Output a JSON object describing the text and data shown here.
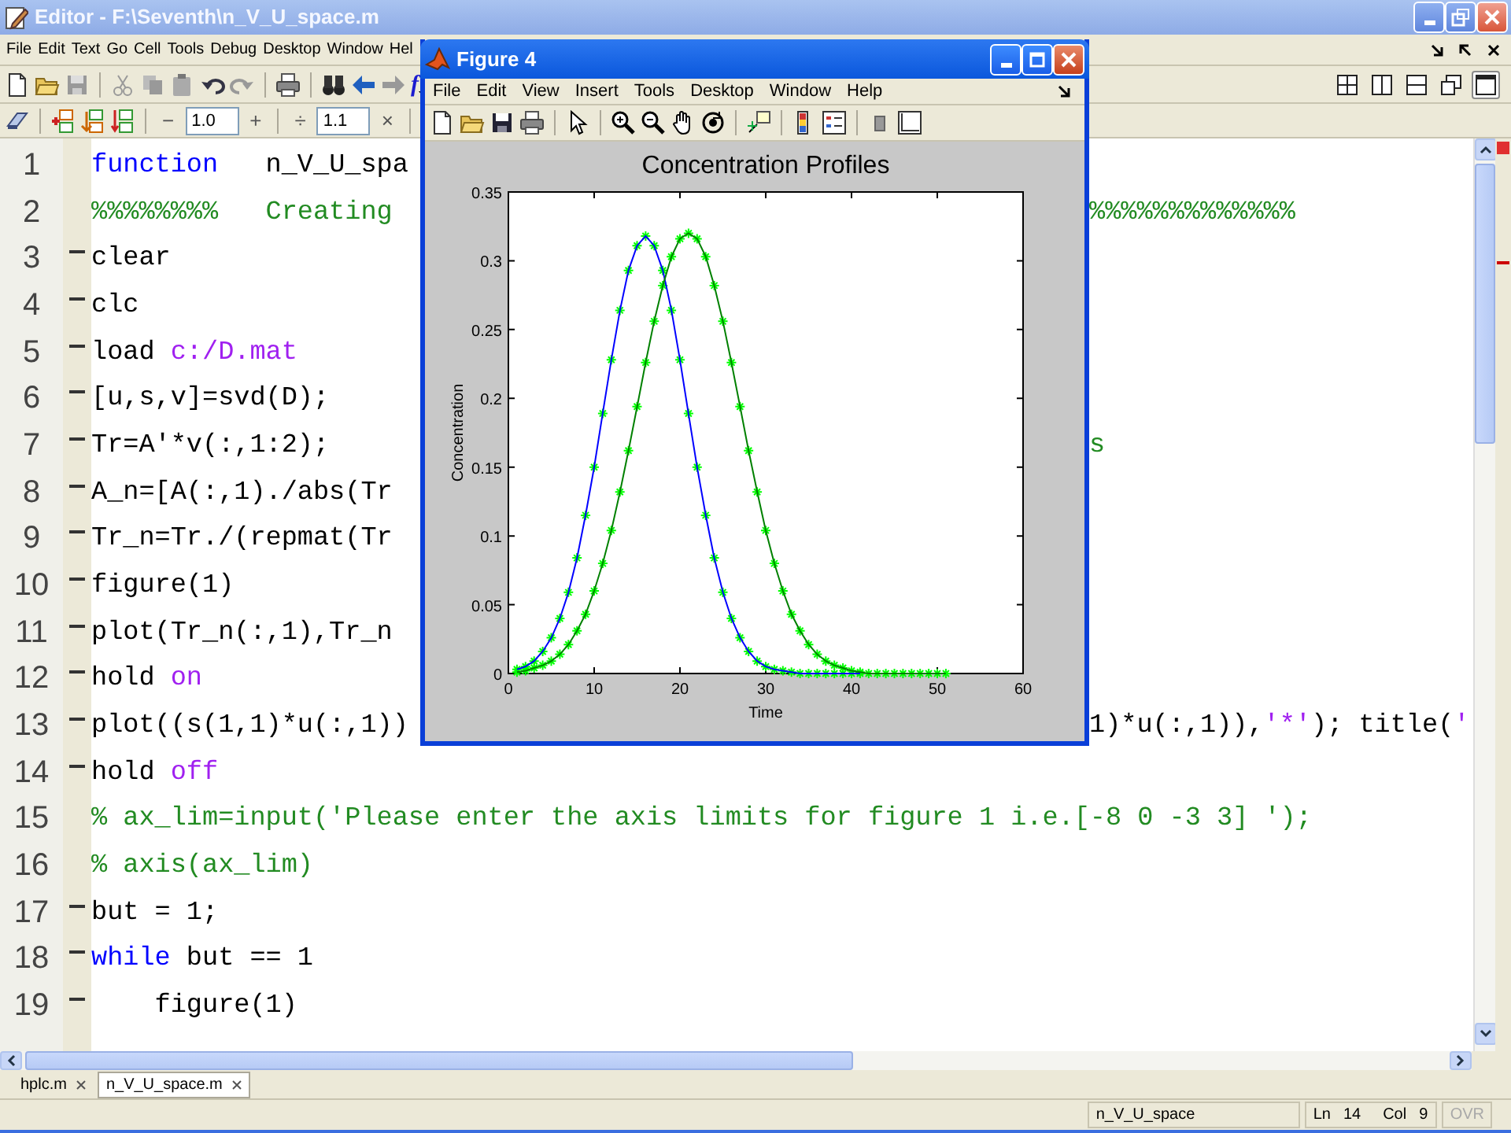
{
  "editor": {
    "title": "Editor - F:\\Seventh\\n_V_U_space.m",
    "menu": [
      "File",
      "Edit",
      "Text",
      "Go",
      "Cell",
      "Tools",
      "Debug",
      "Desktop",
      "Window",
      "Hel"
    ],
    "function_button": "f",
    "cell_tools": [
      {
        "before": "−",
        "value": "1.0",
        "after": "+"
      },
      {
        "before": "÷",
        "value": "1.1",
        "after": "×"
      }
    ],
    "layout_buttons": [
      {
        "kind": "tile",
        "selected": false
      },
      {
        "kind": "columns",
        "selected": false
      },
      {
        "kind": "rows",
        "selected": false
      },
      {
        "kind": "float",
        "selected": false
      },
      {
        "kind": "maximize",
        "selected": true
      }
    ],
    "lines": [
      {
        "number": "1",
        "executable": false,
        "code": [
          {
            "kind": "keyword",
            "text": "function"
          },
          {
            "kind": "plain",
            "text": "   n_V_U_spa"
          }
        ]
      },
      {
        "number": "2",
        "executable": false,
        "code": [
          {
            "kind": "comment",
            "text": "%%%%%%%%   Creating"
          }
        ],
        "code_right": [
          {
            "kind": "comment",
            "text": "%%%%%%%%%%%%%"
          }
        ]
      },
      {
        "number": "3",
        "executable": true,
        "code": [
          {
            "kind": "plain",
            "text": "clear"
          }
        ]
      },
      {
        "number": "4",
        "executable": true,
        "code": [
          {
            "kind": "plain",
            "text": "clc"
          }
        ]
      },
      {
        "number": "5",
        "executable": true,
        "code": [
          {
            "kind": "plain",
            "text": "load "
          },
          {
            "kind": "string",
            "text": "c:/D.mat"
          }
        ]
      },
      {
        "number": "6",
        "executable": true,
        "code": [
          {
            "kind": "plain",
            "text": "[u,s,v]=svd(D);"
          }
        ]
      },
      {
        "number": "7",
        "executable": true,
        "code": [
          {
            "kind": "plain",
            "text": "Tr=A'*v(:,1:2);"
          }
        ],
        "code_right": [
          {
            "kind": "comment",
            "text": "s"
          }
        ]
      },
      {
        "number": "8",
        "executable": true,
        "code": [
          {
            "kind": "plain",
            "text": "A_n=[A(:,1)./abs(Tr"
          }
        ]
      },
      {
        "number": "9",
        "executable": true,
        "code": [
          {
            "kind": "plain",
            "text": "Tr_n=Tr./(repmat(Tr"
          }
        ]
      },
      {
        "number": "10",
        "executable": true,
        "code": [
          {
            "kind": "plain",
            "text": "figure(1)"
          }
        ]
      },
      {
        "number": "11",
        "executable": true,
        "code": [
          {
            "kind": "plain",
            "text": "plot(Tr_n(:,1),Tr_n"
          }
        ]
      },
      {
        "number": "12",
        "executable": true,
        "code": [
          {
            "kind": "plain",
            "text": "hold "
          },
          {
            "kind": "string",
            "text": "on"
          }
        ]
      },
      {
        "number": "13",
        "executable": true,
        "code": [
          {
            "kind": "plain",
            "text": "plot((s(1,1)*u(:,1))"
          }
        ],
        "code_right": [
          {
            "kind": "plain",
            "text": "1)*u(:,1)),"
          },
          {
            "kind": "string",
            "text": "'*'"
          },
          {
            "kind": "plain",
            "text": "); title("
          },
          {
            "kind": "string",
            "text": "'"
          }
        ]
      },
      {
        "number": "14",
        "executable": true,
        "code": [
          {
            "kind": "plain",
            "text": "hold "
          },
          {
            "kind": "string",
            "text": "off"
          }
        ]
      },
      {
        "number": "15",
        "executable": false,
        "code": [
          {
            "kind": "comment",
            "text": "% ax_lim=input('Please enter the axis limits for figure 1 i.e.[-8 0 -3 3] ');"
          }
        ]
      },
      {
        "number": "16",
        "executable": false,
        "code": [
          {
            "kind": "comment",
            "text": "% axis(ax_lim)"
          }
        ]
      },
      {
        "number": "17",
        "executable": true,
        "code": [
          {
            "kind": "plain",
            "text": "but = 1;"
          }
        ]
      },
      {
        "number": "18",
        "executable": true,
        "code": [
          {
            "kind": "keyword",
            "text": "while"
          },
          {
            "kind": "plain",
            "text": " but == 1"
          }
        ]
      },
      {
        "number": "19",
        "executable": true,
        "code": [
          {
            "kind": "plain",
            "text": "    figure(1)"
          }
        ]
      }
    ],
    "tabs": [
      {
        "label": "hplc.m",
        "selected": false
      },
      {
        "label": "n_V_U_space.m",
        "selected": true
      }
    ],
    "status_bar": {
      "function": "n_V_U_space",
      "line_label": "Ln",
      "line": "14",
      "column_label": "Col",
      "column": "9",
      "overwrite": "OVR",
      "overwrite_active": false
    }
  },
  "figure": {
    "title": "Figure 4",
    "menu": [
      "File",
      "Edit",
      "View",
      "Insert",
      "Tools",
      "Desktop",
      "Window",
      "Help"
    ],
    "chart_data": {
      "type": "line",
      "title": "Concentration Profiles",
      "xlabel": "Time",
      "ylabel": "Concentration",
      "xlim": [
        0,
        60
      ],
      "ylim": [
        0,
        0.35
      ],
      "xticks": [
        0,
        10,
        20,
        30,
        40,
        50,
        60
      ],
      "yticks": [
        0,
        0.05,
        {
          "value": 0.1,
          "label": "0.1"
        },
        0.15,
        {
          "value": 0.2,
          "label": "0.2"
        },
        0.25,
        {
          "value": 0.3,
          "label": "0.3"
        },
        0.35
      ],
      "x": [
        1,
        2,
        3,
        4,
        5,
        6,
        7,
        8,
        9,
        10,
        11,
        12,
        13,
        14,
        15,
        16,
        17,
        18,
        19,
        20,
        21,
        22,
        23,
        24,
        25,
        26,
        27,
        28,
        29,
        30,
        31,
        32,
        33,
        34,
        35,
        36,
        37,
        38,
        39,
        40,
        41,
        42,
        43,
        44,
        45,
        46,
        47,
        48,
        49,
        50,
        51
      ],
      "series": [
        {
          "color": "#0000ff",
          "values": [
            0.003,
            0.005,
            0.009,
            0.016,
            0.026,
            0.04,
            0.059,
            0.084,
            0.115,
            0.15,
            0.189,
            0.228,
            0.264,
            0.293,
            0.311,
            0.318,
            0.311,
            0.293,
            0.264,
            0.228,
            0.189,
            0.15,
            0.115,
            0.084,
            0.059,
            0.04,
            0.026,
            0.016,
            0.009,
            0.005,
            0.003,
            0.002,
            0.001,
            0,
            0,
            0,
            0,
            0,
            0,
            0,
            0,
            null,
            null,
            null,
            null,
            null,
            null,
            null,
            null,
            null,
            null
          ]
        },
        {
          "color": "#008000",
          "values": [
            0.001,
            0.002,
            0.004,
            0.006,
            0.009,
            0.014,
            0.021,
            0.031,
            0.043,
            0.06,
            0.08,
            0.104,
            0.132,
            0.162,
            0.194,
            0.226,
            0.256,
            0.282,
            0.303,
            0.316,
            0.32,
            0.316,
            0.303,
            0.282,
            0.256,
            0.226,
            0.194,
            0.162,
            0.132,
            0.104,
            0.08,
            0.06,
            0.043,
            0.031,
            0.021,
            0.014,
            0.009,
            0.006,
            0.004,
            0.002,
            0.001,
            0,
            0,
            0,
            0,
            0,
            0,
            0,
            0,
            0,
            0
          ]
        }
      ]
    }
  }
}
